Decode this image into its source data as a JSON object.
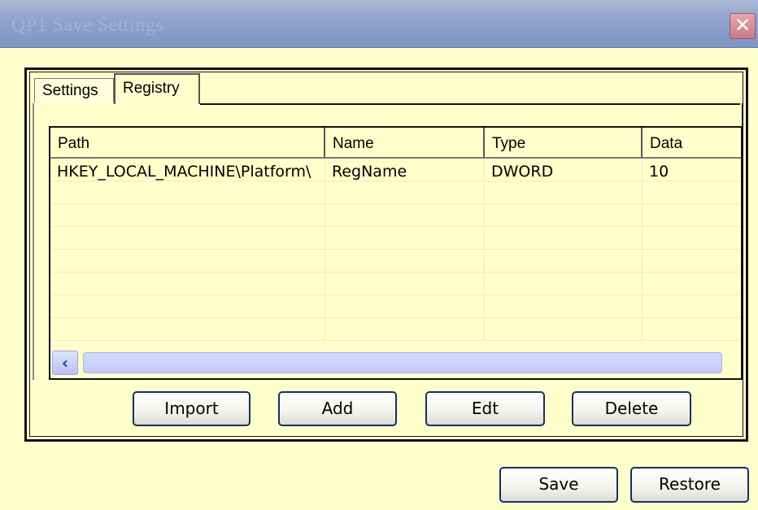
{
  "window": {
    "title": "QP1 Save Settings",
    "close_glyph": "✕"
  },
  "tabs": [
    {
      "label": "Settings",
      "selected": false
    },
    {
      "label": "Registry",
      "selected": true
    }
  ],
  "table": {
    "columns": [
      "Path",
      "Name",
      "Type",
      "Data"
    ],
    "rows": [
      [
        "HKEY_LOCAL_MACHINE\\Platform\\",
        "RegName",
        "DWORD",
        "10"
      ]
    ]
  },
  "scrollbar": {
    "left_arrow": "‹"
  },
  "panel_buttons": {
    "import": "Import",
    "add": "Add",
    "edit": "Edt",
    "delete": "Delete"
  },
  "footer_buttons": {
    "save": "Save",
    "restore": "Restore"
  },
  "colors": {
    "window_bg": "#ffffcc",
    "titlebar": "#8fa4cc",
    "close_button": "#c97a86",
    "scroll_thumb": "#c4cbf6",
    "button_border": "#17305f"
  },
  "icons": [
    "close-icon",
    "scroll-left-arrow-icon"
  ]
}
